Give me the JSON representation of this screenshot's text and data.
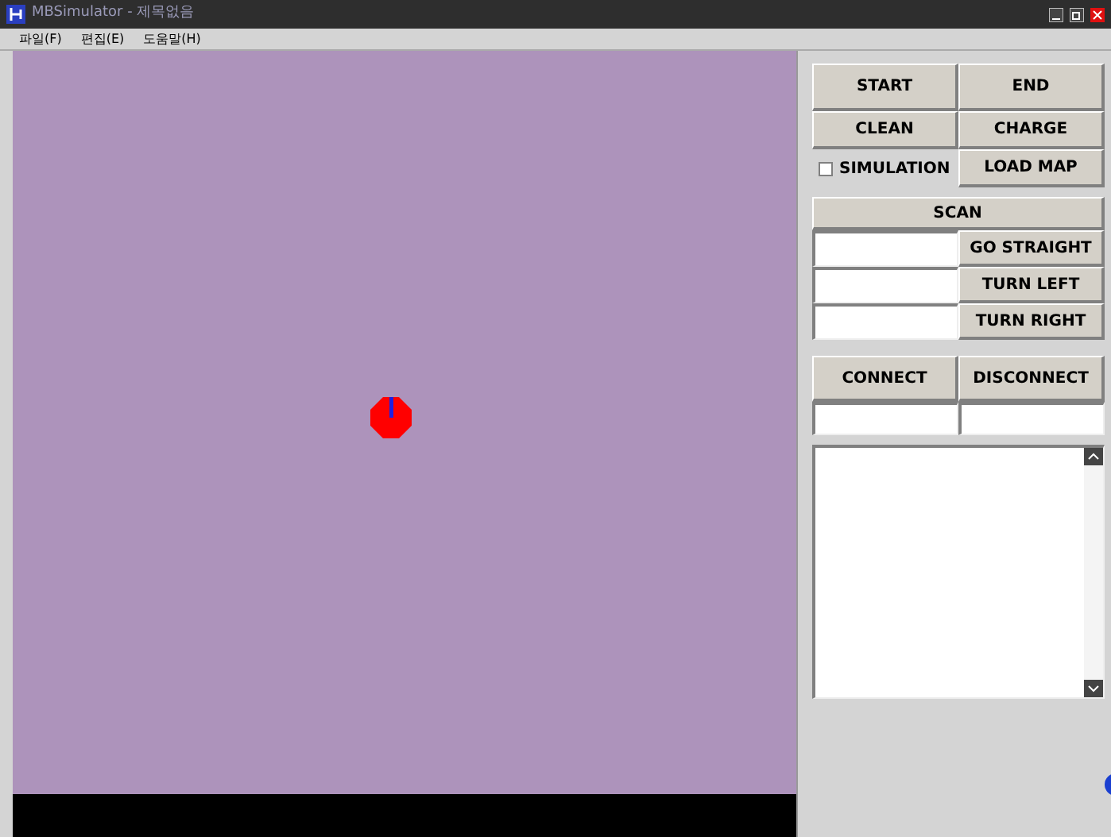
{
  "window": {
    "title": "MBSimulator - 제목없음"
  },
  "menu": [
    "파일(F)",
    "편집(E)",
    "도움말(H)"
  ],
  "controls": {
    "top_buttons": [
      "START",
      "END",
      "CLEAN",
      "CHARGE"
    ],
    "simulation": {
      "label": "SIMULATION",
      "checked": false
    },
    "load_map": "LOAD MAP",
    "scan": "SCAN",
    "move_buttons": [
      "GO STRAIGHT",
      "TURN LEFT",
      "TURN RIGHT"
    ],
    "connect": "CONNECT",
    "disconnect": "DISCONNECT"
  }
}
